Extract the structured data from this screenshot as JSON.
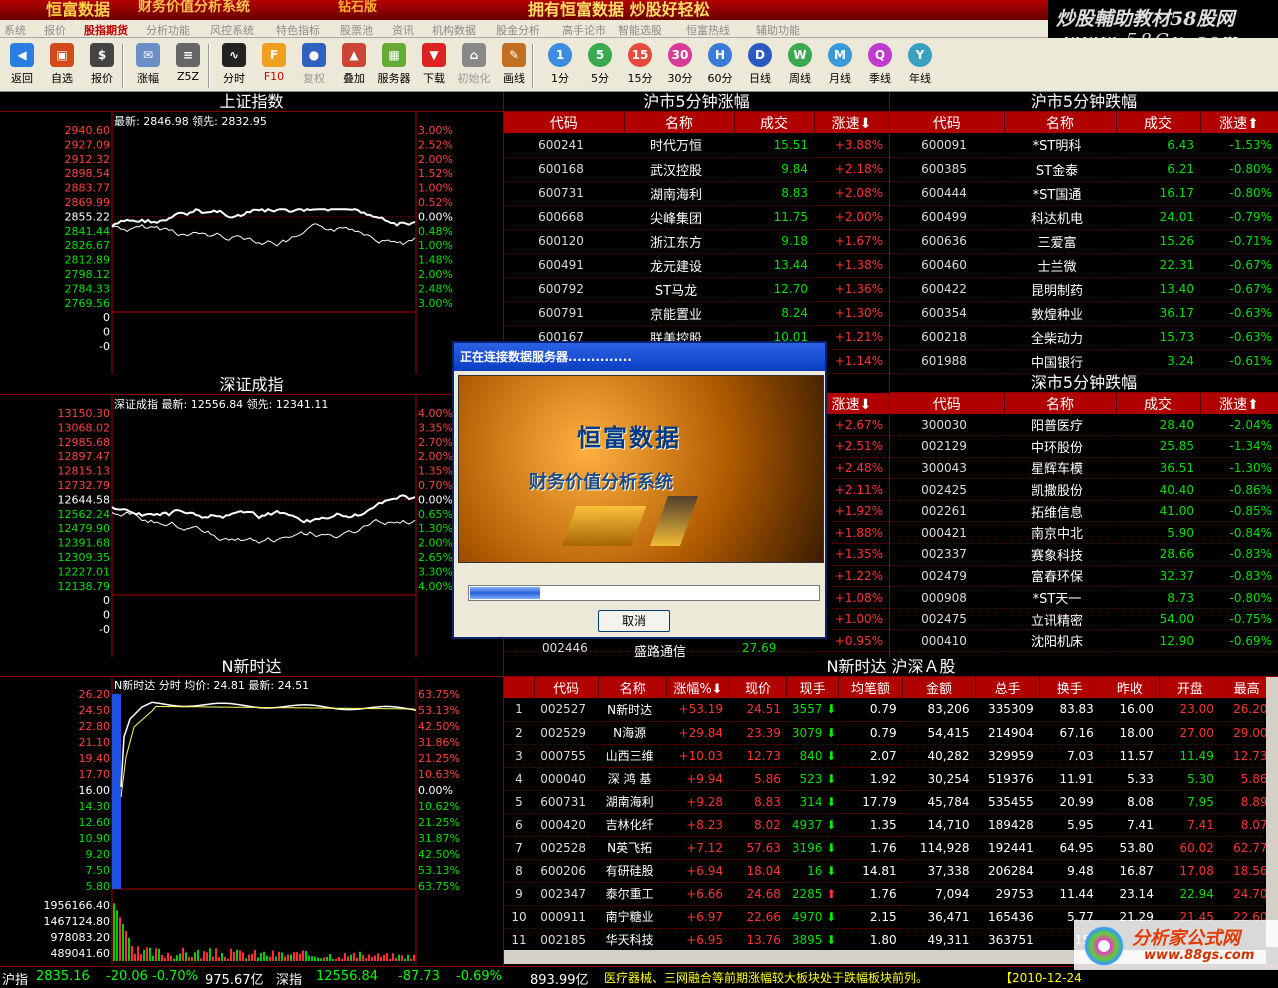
{
  "titlebar": {
    "brand": "恒富数据",
    "system": "财务价值分析系统",
    "edition": "钻石版",
    "slogan": "拥有恒富数据 炒股好轻松"
  },
  "watermark_top": {
    "line1": "炒股輔助教材58股网",
    "line2": "www.58Gu.com"
  },
  "menu": [
    "系统",
    "报价",
    "股指期货",
    "分析功能",
    "风控系统",
    "特色指标",
    "股票池",
    "资讯",
    "机构数据",
    "股金分析",
    "高手论市",
    "智能选股",
    "恒富热线",
    "辅助功能"
  ],
  "menu_active": 2,
  "toolbar": [
    {
      "label": "返回",
      "icon": "back-arrow-icon",
      "color": "#2a7de1"
    },
    {
      "label": "自选",
      "icon": "basket-icon",
      "color": "#d04a1a"
    },
    {
      "label": "报价",
      "icon": "price-board-icon",
      "color": "#444"
    },
    {
      "label": "涨幅",
      "icon": "envelope-icon",
      "color": "#6a8fc4"
    },
    {
      "label": "Z5Z",
      "icon": "gear-stack-icon",
      "color": "#666"
    },
    {
      "label": "分时",
      "icon": "timeline-chart-icon",
      "color": "#222"
    },
    {
      "label": "F10",
      "icon": "f10-icon",
      "color": "#f0a020"
    },
    {
      "label": "复权",
      "icon": "person-icon",
      "color": "#3060c0"
    },
    {
      "label": "叠加",
      "icon": "overlay-icon",
      "color": "#c43"
    },
    {
      "label": "服务器",
      "icon": "server-icon",
      "color": "#6a3"
    },
    {
      "label": "下载",
      "icon": "download-icon",
      "color": "#d22"
    },
    {
      "label": "初始化",
      "icon": "home-icon",
      "color": "#888"
    },
    {
      "label": "画线",
      "icon": "draw-line-icon",
      "color": "#c07020"
    },
    {
      "label": "1分",
      "icon": "circle-1-icon",
      "color": "#3a8de0"
    },
    {
      "label": "5分",
      "icon": "circle-5-icon",
      "color": "#3aaa50"
    },
    {
      "label": "15分",
      "icon": "circle-15-icon",
      "color": "#e64a3a"
    },
    {
      "label": "30分",
      "icon": "circle-30-icon",
      "color": "#d83a9a"
    },
    {
      "label": "60分",
      "icon": "circle-h-icon",
      "color": "#3a7ad8"
    },
    {
      "label": "日线",
      "icon": "circle-d-icon",
      "color": "#2a5ac0"
    },
    {
      "label": "周线",
      "icon": "circle-w-icon",
      "color": "#3aaa50"
    },
    {
      "label": "月线",
      "icon": "circle-m-icon",
      "color": "#3a9ad8"
    },
    {
      "label": "季线",
      "icon": "circle-q-icon",
      "color": "#c03ad0"
    },
    {
      "label": "年线",
      "icon": "circle-y-icon",
      "color": "#3aa0c0"
    }
  ],
  "panels": {
    "sh_index": {
      "title": "上证指数",
      "info": "最新: 2846.98 领先: 2832.95",
      "left_ticks": [
        "2940.60",
        "2927.09",
        "2912.32",
        "2898.54",
        "2883.77",
        "2869.99",
        "2855.22",
        "2841.44",
        "2826.67",
        "2812.89",
        "2798.12",
        "2784.33",
        "2769.56",
        "0",
        "0",
        "-0"
      ],
      "right_ticks": [
        "3.00%",
        "2.52%",
        "2.00%",
        "1.52%",
        "1.00%",
        "0.52%",
        "0.00%",
        "0.48%",
        "1.00%",
        "1.48%",
        "2.00%",
        "2.48%",
        "3.00%"
      ]
    },
    "sz_index": {
      "title": "深证成指",
      "info": "深证成指 最新: 12556.84 领先: 12341.11",
      "left_ticks": [
        "13150.30",
        "13068.02",
        "12985.68",
        "12897.47",
        "12815.13",
        "12732.79",
        "12644.58",
        "12562.24",
        "12479.90",
        "12391.68",
        "12309.35",
        "12227.01",
        "12138.79",
        "0",
        "0",
        "-0"
      ],
      "right_ticks": [
        "4.00%",
        "3.35%",
        "2.70%",
        "2.00%",
        "1.35%",
        "0.70%",
        "0.00%",
        "0.65%",
        "1.30%",
        "2.00%",
        "2.65%",
        "3.30%",
        "4.00%"
      ]
    },
    "stock": {
      "title": "N新时达",
      "info": "N新时达 分时 均价: 24.81 最新: 24.51",
      "left_ticks": [
        "26.20",
        "24.50",
        "22.80",
        "21.10",
        "19.40",
        "17.70",
        "16.00",
        "14.30",
        "12.60",
        "10.90",
        "9.20",
        "7.50",
        "5.80"
      ],
      "right_ticks": [
        "63.75%",
        "53.13%",
        "42.50%",
        "31.86%",
        "21.25%",
        "10.63%",
        "0.00%",
        "10.62%",
        "21.25%",
        "31.87%",
        "42.50%",
        "53.13%",
        "63.75%"
      ],
      "vol_ticks": [
        "1956166.40",
        "1467124.80",
        "978083.20",
        "489041.60"
      ]
    }
  },
  "sh_gain": {
    "title": "沪市5分钟涨幅",
    "headers": [
      "代码",
      "名称",
      "成交",
      "涨速"
    ],
    "sort_icon": "arrow-down-icon",
    "rows": [
      [
        "600241",
        "时代万恒",
        "15.51",
        "+3.88%"
      ],
      [
        "600168",
        "武汉控股",
        "9.84",
        "+2.18%"
      ],
      [
        "600731",
        "湖南海利",
        "8.83",
        "+2.08%"
      ],
      [
        "600668",
        "尖峰集团",
        "11.75",
        "+2.00%"
      ],
      [
        "600120",
        "浙江东方",
        "9.18",
        "+1.67%"
      ],
      [
        "600491",
        "龙元建设",
        "13.44",
        "+1.38%"
      ],
      [
        "600792",
        "ST马龙",
        "12.70",
        "+1.36%"
      ],
      [
        "600791",
        "京能置业",
        "8.24",
        "+1.30%"
      ],
      [
        "600167",
        "联美控股",
        "10.01",
        "+1.21%"
      ],
      [
        "",
        "",
        "",
        "+1.14%"
      ]
    ]
  },
  "sh_loss": {
    "title": "沪市5分钟跌幅",
    "headers": [
      "代码",
      "名称",
      "成交",
      "涨速"
    ],
    "sort_icon": "arrow-up-icon",
    "rows": [
      [
        "600091",
        "*ST明科",
        "6.43",
        "-1.53%"
      ],
      [
        "600385",
        "ST金泰",
        "6.21",
        "-0.80%"
      ],
      [
        "600444",
        "*ST国通",
        "16.17",
        "-0.80%"
      ],
      [
        "600499",
        "科达机电",
        "24.01",
        "-0.79%"
      ],
      [
        "600636",
        "三爱富",
        "15.26",
        "-0.71%"
      ],
      [
        "600460",
        "士兰微",
        "22.31",
        "-0.67%"
      ],
      [
        "600422",
        "昆明制药",
        "13.40",
        "-0.67%"
      ],
      [
        "600354",
        "敦煌种业",
        "36.17",
        "-0.63%"
      ],
      [
        "600218",
        "全柴动力",
        "15.73",
        "-0.63%"
      ],
      [
        "601988",
        "中国银行",
        "3.24",
        "-0.61%"
      ]
    ]
  },
  "sz_gain": {
    "headers": [
      "涨速"
    ],
    "sort_icon": "arrow-down-icon",
    "rows": [
      [
        "+2.67%"
      ],
      [
        "+2.51%"
      ],
      [
        "+2.48%"
      ],
      [
        "+2.11%"
      ],
      [
        "+1.92%"
      ],
      [
        "+1.88%"
      ],
      [
        "+1.35%"
      ],
      [
        "+1.22%"
      ],
      [
        "+1.08%"
      ],
      [
        "+1.00%"
      ],
      [
        "+0.95%"
      ]
    ],
    "last_row": {
      "code": "002446",
      "name": "盛路通信",
      "price": "27.69"
    }
  },
  "sz_loss": {
    "title": "深市5分钟跌幅",
    "headers": [
      "代码",
      "名称",
      "成交",
      "涨速"
    ],
    "sort_icon": "arrow-up-icon",
    "rows": [
      [
        "300030",
        "阳普医疗",
        "28.40",
        "-2.04%"
      ],
      [
        "002129",
        "中环股份",
        "25.85",
        "-1.34%"
      ],
      [
        "300043",
        "星辉车模",
        "36.51",
        "-1.30%"
      ],
      [
        "002425",
        "凯撒股份",
        "40.40",
        "-0.86%"
      ],
      [
        "002261",
        "拓维信息",
        "41.00",
        "-0.85%"
      ],
      [
        "000421",
        "南京中北",
        "5.90",
        "-0.84%"
      ],
      [
        "002337",
        "赛象科技",
        "28.66",
        "-0.83%"
      ],
      [
        "002479",
        "富春环保",
        "32.37",
        "-0.83%"
      ],
      [
        "000908",
        "*ST天一",
        "8.73",
        "-0.80%"
      ],
      [
        "002475",
        "立讯精密",
        "54.00",
        "-0.75%"
      ],
      [
        "000410",
        "沈阳机床",
        "12.90",
        "-0.69%"
      ]
    ]
  },
  "big_table": {
    "title": "N新时达 沪深Ａ股",
    "headers": [
      "",
      "代码",
      "名称",
      "涨幅%",
      "现价",
      "现手",
      "均笔额",
      "金额",
      "总手",
      "换手",
      "昨收",
      "开盘",
      "最高"
    ],
    "rows": [
      [
        "1",
        "002527",
        "N新时达",
        "+53.19",
        "24.51",
        "3557",
        "0.79",
        "83,206",
        "335309",
        "83.83",
        "16.00",
        "23.00",
        "26.20"
      ],
      [
        "2",
        "002529",
        "N海源",
        "+29.84",
        "23.39",
        "3079",
        "0.79",
        "54,415",
        "214904",
        "67.16",
        "18.00",
        "27.00",
        "29.00"
      ],
      [
        "3",
        "000755",
        "山西三维",
        "+10.03",
        "12.73",
        "840",
        "2.07",
        "40,282",
        "329959",
        "7.03",
        "11.57",
        "11.49",
        "12.73"
      ],
      [
        "4",
        "000040",
        "深 鸿 基",
        "+9.94",
        "5.86",
        "523",
        "1.92",
        "30,254",
        "519376",
        "11.91",
        "5.33",
        "5.30",
        "5.86"
      ],
      [
        "5",
        "600731",
        "湖南海利",
        "+9.28",
        "8.83",
        "314",
        "17.79",
        "45,784",
        "535455",
        "20.99",
        "8.08",
        "7.95",
        "8.89"
      ],
      [
        "6",
        "000420",
        "吉林化纤",
        "+8.23",
        "8.02",
        "4937",
        "1.35",
        "14,710",
        "189428",
        "5.95",
        "7.41",
        "7.41",
        "8.07"
      ],
      [
        "7",
        "002528",
        "N英飞拓",
        "+7.12",
        "57.63",
        "3196",
        "1.76",
        "114,928",
        "192441",
        "64.95",
        "53.80",
        "60.02",
        "62.77"
      ],
      [
        "8",
        "600206",
        "有研硅股",
        "+6.94",
        "18.04",
        "16",
        "14.81",
        "37,338",
        "206284",
        "9.48",
        "16.87",
        "17.08",
        "18.56"
      ],
      [
        "9",
        "002347",
        "泰尔重工",
        "+6.66",
        "24.68",
        "2285",
        "1.76",
        "7,094",
        "29753",
        "11.44",
        "23.14",
        "22.94",
        "24.70"
      ],
      [
        "10",
        "000911",
        "南宁糖业",
        "+6.97",
        "22.66",
        "4970",
        "2.15",
        "36,471",
        "165436",
        "5.77",
        "21.29",
        "21.45",
        "22.60"
      ],
      [
        "11",
        "002185",
        "华天科技",
        "+6.95",
        "13.76",
        "3895",
        "1.80",
        "49,311",
        "363751",
        "15.",
        "",
        "",
        ""
      ]
    ],
    "hand_dir": [
      "down",
      "down",
      "down",
      "down",
      "down",
      "down",
      "down",
      "down",
      "up",
      "down",
      "down"
    ]
  },
  "status": {
    "sh_label": "沪指",
    "sh_val": "2835.16",
    "sh_chg": "-20.06",
    "sh_pct": "-0.70%",
    "sh_amt": "975.67亿",
    "sz_label": "深指",
    "sz_val": "12556.84",
    "sz_chg": "-87.73",
    "sz_pct": "-0.69%",
    "sz_amt": "893.99亿",
    "news": "医疗器械、三网融合等前期涨幅较大板块处于跌幅板块前列。",
    "date": "【2010-12-24"
  },
  "dialog": {
    "caption": "正在连接数据服务器..............",
    "brand": "恒富数据",
    "subtitle": "财务价值分析系统",
    "progress": 0.2,
    "cancel": "取消"
  },
  "watermark_bottom": {
    "line1": "分析家公式网",
    "line2": "www.88gs.com"
  }
}
